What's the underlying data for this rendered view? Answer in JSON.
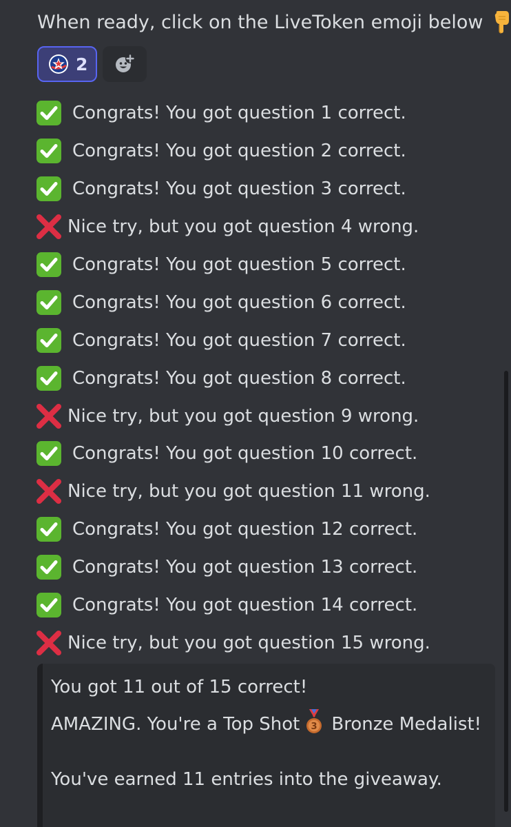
{
  "message": {
    "intro_text": "When ready, click on the LiveToken emoji below",
    "intro_end": ".",
    "pointer_icon": "backhand-index-pointing-down-emoji"
  },
  "reactions": {
    "livetoken": {
      "icon": "livetoken-icon",
      "count": "2",
      "selected": true
    },
    "add_reaction": {
      "icon": "add-reaction-icon"
    }
  },
  "colors": {
    "background": "#313338",
    "text": "#dbdee1",
    "reaction_bg": "#3c3f77",
    "reaction_border": "#5865f2",
    "correct_green": "#5bb52f",
    "wrong_red": "#dd2e44",
    "card_bg": "#2b2d31"
  },
  "results": [
    {
      "status": "correct",
      "icon": "check-mark-button-emoji",
      "text": "Congrats! You got question 1 correct."
    },
    {
      "status": "correct",
      "icon": "check-mark-button-emoji",
      "text": "Congrats! You got question 2 correct."
    },
    {
      "status": "correct",
      "icon": "check-mark-button-emoji",
      "text": "Congrats! You got question 3 correct."
    },
    {
      "status": "wrong",
      "icon": "cross-mark-emoji",
      "text": "Nice try, but you got question 4 wrong."
    },
    {
      "status": "correct",
      "icon": "check-mark-button-emoji",
      "text": "Congrats! You got question 5 correct."
    },
    {
      "status": "correct",
      "icon": "check-mark-button-emoji",
      "text": "Congrats! You got question 6 correct."
    },
    {
      "status": "correct",
      "icon": "check-mark-button-emoji",
      "text": "Congrats! You got question 7 correct."
    },
    {
      "status": "correct",
      "icon": "check-mark-button-emoji",
      "text": "Congrats! You got question 8 correct."
    },
    {
      "status": "wrong",
      "icon": "cross-mark-emoji",
      "text": "Nice try, but you got question 9 wrong."
    },
    {
      "status": "correct",
      "icon": "check-mark-button-emoji",
      "text": "Congrats! You got question 10 correct."
    },
    {
      "status": "wrong",
      "icon": "cross-mark-emoji",
      "text": "Nice try, but you got question 11 wrong."
    },
    {
      "status": "correct",
      "icon": "check-mark-button-emoji",
      "text": "Congrats! You got question 12 correct."
    },
    {
      "status": "correct",
      "icon": "check-mark-button-emoji",
      "text": "Congrats! You got question 13 correct."
    },
    {
      "status": "correct",
      "icon": "check-mark-button-emoji",
      "text": "Congrats! You got question 14 correct."
    },
    {
      "status": "wrong",
      "icon": "cross-mark-emoji",
      "text": "Nice try, but you got question 15 wrong."
    }
  ],
  "summary": {
    "score_text": "You got 11 out of 15 correct!",
    "medal_text_before": "AMAZING. You're a Top Shot",
    "medal_icon": "3rd-place-medal-emoji",
    "medal_text_after": "Bronze Medalist!",
    "entries_text": "You've earned 11 entries into the giveaway."
  }
}
